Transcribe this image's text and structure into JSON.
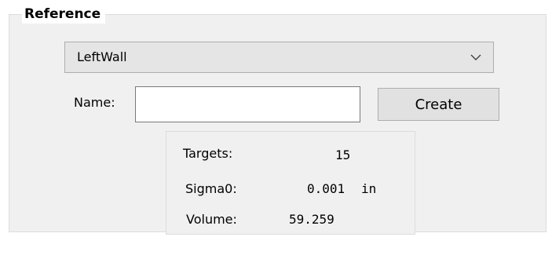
{
  "group": {
    "title": "Reference"
  },
  "reference_select": {
    "selected": "LeftWall",
    "arrow_icon": "chevron-down-icon"
  },
  "name_field": {
    "label": "Name:",
    "value": ""
  },
  "create_button": {
    "label": "Create"
  },
  "stats": {
    "targets_label": "Targets:",
    "targets_value": "15",
    "sigma0_label": "Sigma0:",
    "sigma0_value": "0.001",
    "sigma0_unit": "in",
    "volume_label": "Volume:",
    "volume_value": "59.259"
  }
}
